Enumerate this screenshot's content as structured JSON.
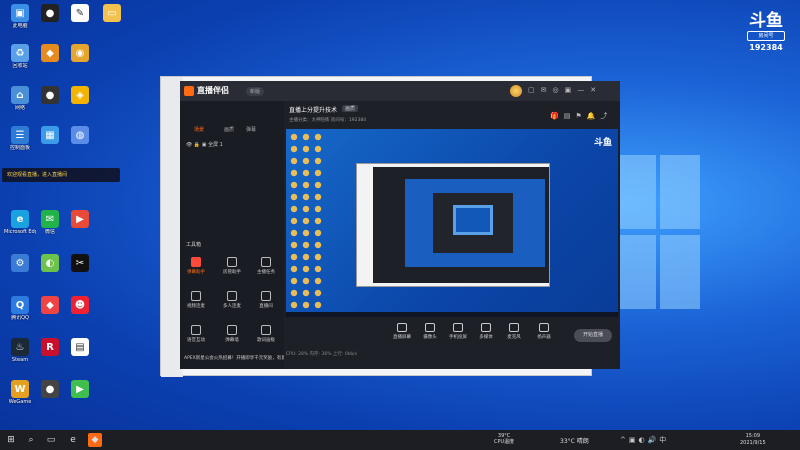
{
  "desktop": {
    "icons": [
      {
        "label": "此电脑",
        "color": "#3a8ee6"
      },
      {
        "label": "回收站",
        "color": "#5aa0e8"
      },
      {
        "label": "网络",
        "color": "#4a90d9"
      },
      {
        "label": "控制面板",
        "color": "#2e7bd6"
      },
      {
        "label": "Microsoft Edge",
        "color": "#1aa1e0"
      },
      {
        "label": "腾讯QQ",
        "color": "#2d7be0"
      },
      {
        "label": "微信",
        "color": "#21b34a"
      },
      {
        "label": "Steam",
        "color": "#1b2838"
      },
      {
        "label": "WeGame",
        "color": "#e4a020"
      }
    ],
    "tooltip": "欢迎观看直播，进入直播间"
  },
  "brand": {
    "mark": "斗鱼",
    "badge": "房间号",
    "room": "192384"
  },
  "app": {
    "name": "直播伴侣",
    "version": "新版",
    "tabs": [
      "场景",
      "画质",
      "弹幕"
    ],
    "scene_item": "全屏 1",
    "toolbox_title": "工具箱",
    "tools": [
      "弹幕助手",
      "房管助手",
      "主播任务",
      "视频连麦",
      "多人连麦",
      "直播间",
      "语音互动",
      "弹幕墙",
      "歌词画板"
    ],
    "room_title": "直播上分提升技术",
    "room_tag": "画质",
    "room_meta": "主播分类：大神陪练  房间号：192384",
    "controls": [
      "直播屏幕",
      "摄像头",
      "手机投屏",
      "多媒体",
      "麦克风",
      "扬声器"
    ],
    "go_live": "开始直播",
    "status": "CPU: 28%  内存: 36%  上行: 0kb/s",
    "notice": "APEX新星公会火热招募！开播即享千元奖励，有意者私信联系！"
  },
  "taskbar": {
    "cpu": "39°C",
    "cpu_label": "CPU温度",
    "weather": "33°C 晴朗",
    "time": "15:09",
    "date": "2021/9/15"
  }
}
